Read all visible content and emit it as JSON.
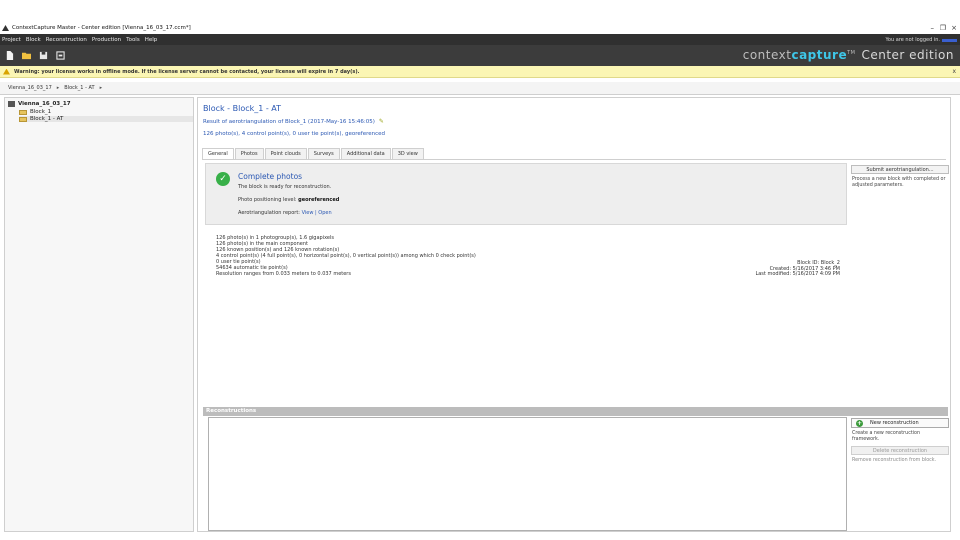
{
  "window": {
    "title": "ContextCapture Master - Center edition [Vienna_16_03_17.ccm*]",
    "controls": {
      "minimize": "–",
      "restore": "❐",
      "close": "×"
    }
  },
  "menu": {
    "items": [
      "Project",
      "Block",
      "Reconstruction",
      "Production",
      "Tools",
      "Help"
    ],
    "login_text": "You are not logged in."
  },
  "toolbar": {
    "icons": [
      "new-document-icon",
      "open-folder-icon",
      "save-icon",
      "settings-icon"
    ],
    "brand_part1": "context",
    "brand_part2": "capture",
    "brand_tm": "TM",
    "brand_edition": "Center edition",
    "accent_color": "#3ec6e8"
  },
  "warning": {
    "text": "Warning: your license works in offline mode. If the license server cannot be contacted, your license will expire in 7 day(s).",
    "close": "x"
  },
  "breadcrumb": {
    "items": [
      "Vienna_16_03_17",
      "Block_1 - AT"
    ],
    "separator": "▸"
  },
  "tree": {
    "project": "Vienna_16_03_17",
    "blocks": [
      "Block_1",
      "Block_1 - AT"
    ]
  },
  "block": {
    "title": "Block - Block_1 - AT",
    "subtitle": "Result of aerotriangulation of Block_1 (2017-May-16 15:46:05)",
    "summary": "126 photo(s), 4 control point(s), 0 user tie point(s), georeferenced"
  },
  "tabs": [
    "General",
    "Photos",
    "Point clouds",
    "Surveys",
    "Additional data",
    "3D view"
  ],
  "status_panel": {
    "heading": "Complete photos",
    "ready_text": "The block is ready for reconstruction.",
    "geo_label": "Photo positioning level:",
    "geo_value": "georeferenced",
    "report_label": "Aerotriangulation report:",
    "report_link": "View | Open"
  },
  "side_actions": {
    "submit_label": "Submit aerotriangulation...",
    "submit_desc": "Process a new block with completed or adjusted parameters."
  },
  "stats": [
    "126 photo(s) in 1 photogroup(s), 1.6 gigapixels",
    "126 photo(s) in the main component",
    "126 known position(s) and 126 known rotation(s)",
    "4 control point(s) (4 full point(s), 0 horizontal point(s), 0 vertical point(s)) among which 0 check point(s)",
    "0 user tie point(s)",
    "54634 automatic tie point(s)",
    "Resolution ranges from 0.033 meters to 0.037 meters"
  ],
  "meta": {
    "block_id": "Block ID: Block_2",
    "created": "Created: 5/16/2017 3:46 PM",
    "modified": "Last modified: 5/16/2017 4:09 PM"
  },
  "reconstructions": {
    "header": "Reconstructions",
    "new_label": "New reconstruction",
    "new_desc": "Create a new reconstruction framework.",
    "delete_label": "Delete reconstruction",
    "delete_desc": "Remove reconstruction from block."
  }
}
